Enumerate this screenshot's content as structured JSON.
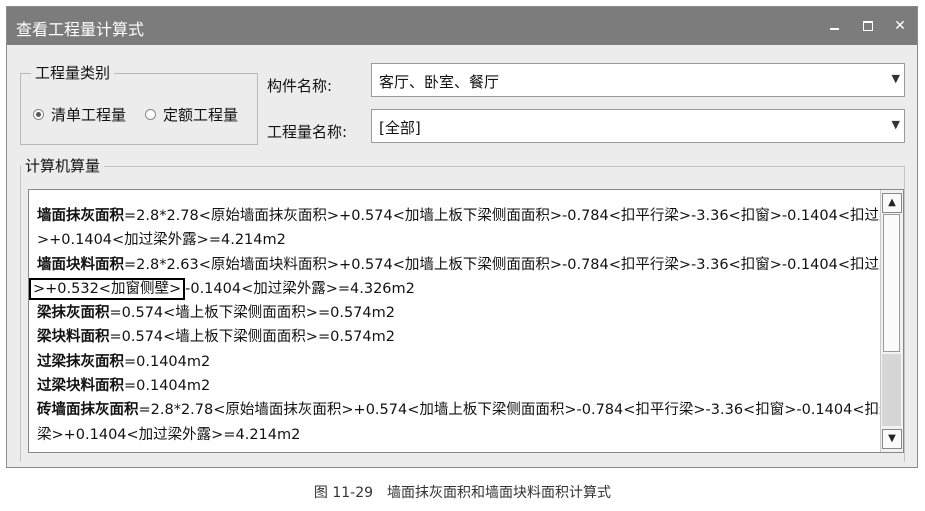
{
  "window": {
    "title": "查看工程量计算式"
  },
  "category": {
    "legend": "工程量类别",
    "options": [
      {
        "label": "清单工程量",
        "selected": true
      },
      {
        "label": "定额工程量",
        "selected": false
      }
    ]
  },
  "fields": {
    "component_label": "构件名称:",
    "component_value": "客厅、卧室、餐厅",
    "quantity_label": "工程量名称:",
    "quantity_value": "[全部]"
  },
  "calc": {
    "legend": "计算机算量",
    "lines": [
      {
        "bold": "墙面抹灰面积",
        "text": "=2.8*2.78<原始墙面抹灰面积>+0.574<加墙上板下梁侧面面积>-0.784<扣平行梁>-3.36<扣窗>-0.1404<扣过梁"
      },
      {
        "bold": "",
        "text": ">+0.1404<加过梁外露>=4.214m2"
      },
      {
        "bold": "墙面块料面积",
        "text": "=2.8*2.63<原始墙面块料面积>+0.574<加墙上板下梁侧面面积>-0.784<扣平行梁>-3.36<扣窗>-0.1404<扣过梁"
      },
      {
        "bold": "",
        "boxed": ">+0.532<加窗侧壁>",
        "text": "-0.1404<加过梁外露>=4.326m2"
      },
      {
        "bold": "梁抹灰面积",
        "text": "=0.574<墙上板下梁侧面面积>=0.574m2"
      },
      {
        "bold": "梁块料面积",
        "text": "=0.574<墙上板下梁侧面面积>=0.574m2"
      },
      {
        "bold": "过梁抹灰面积",
        "text": "=0.1404m2"
      },
      {
        "bold": "过梁块料面积",
        "text": "=0.1404m2"
      },
      {
        "bold": "砖墙面抹灰面积",
        "text": "=2.8*2.78<原始墙面抹灰面积>+0.574<加墙上板下梁侧面面积>-0.784<扣平行梁>-3.36<扣窗>-0.1404<扣过"
      },
      {
        "bold": "",
        "text": "梁>+0.1404<加过梁外露>=4.214m2"
      }
    ]
  },
  "caption": "图 11-29　墙面抹灰面积和墙面块料面积计算式"
}
